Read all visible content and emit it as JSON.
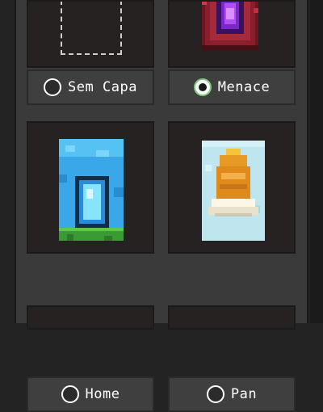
{
  "capes": [
    {
      "label": "Sem Capa",
      "selected": false,
      "preview": "empty-cape-placeholder"
    },
    {
      "label": "Menace",
      "selected": true,
      "preview": "menace-cape-icon"
    },
    {
      "label": "Home",
      "selected": false,
      "preview": "home-cape-icon"
    },
    {
      "label": "Pan",
      "selected": false,
      "preview": "pan-cape-icon"
    }
  ],
  "colors": {
    "background": "#232323",
    "panel": "#3a3a3a",
    "selected_ring": "#7ec97e"
  }
}
